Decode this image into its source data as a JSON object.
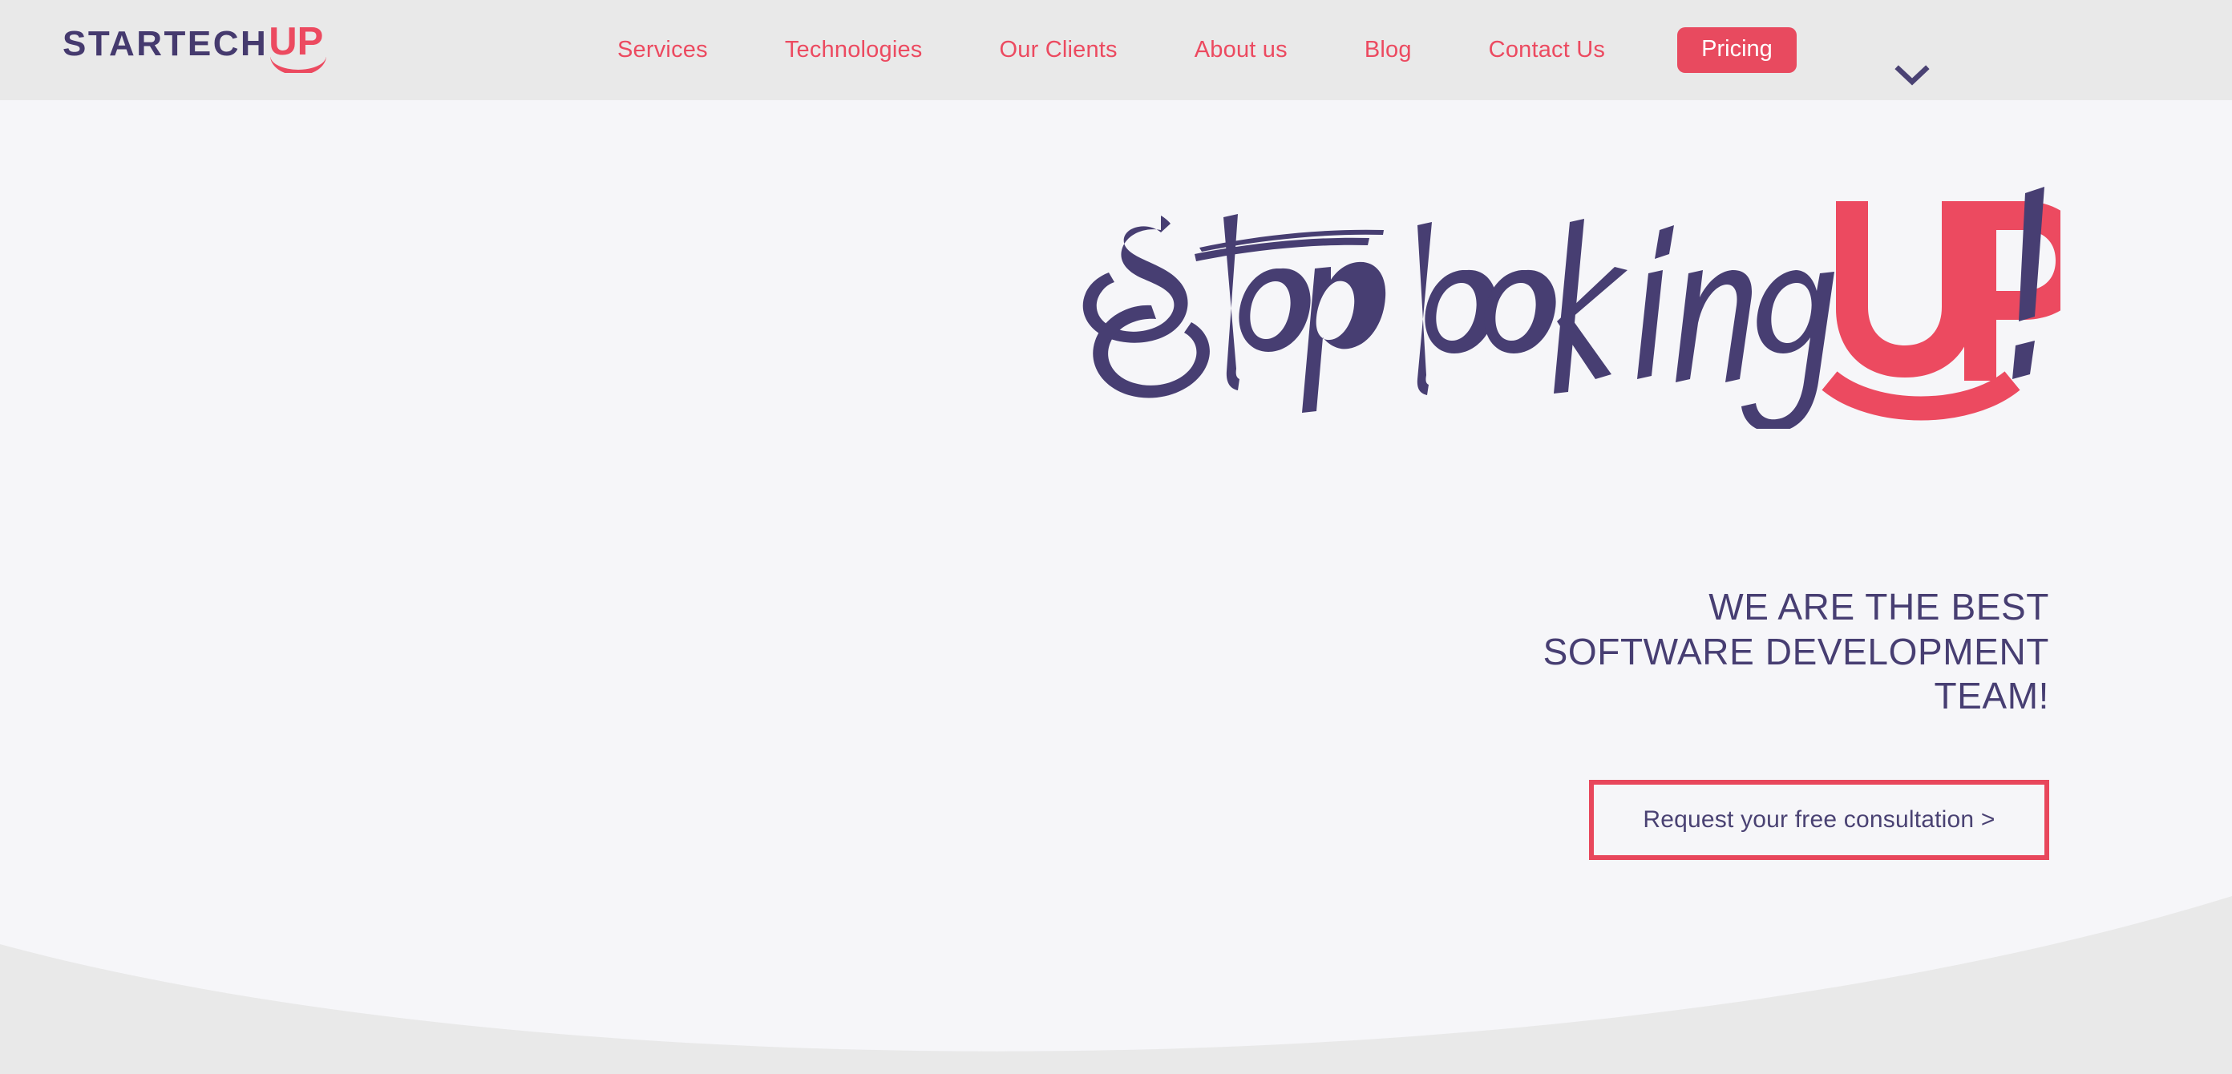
{
  "header": {
    "logo": {
      "primary_text": "STARTECH",
      "accent_text": "UP",
      "primary_color": "#453a6e",
      "accent_color": "#ec4a60",
      "smile_icon": "smile-arc-icon"
    },
    "nav_items": [
      {
        "label": "Services"
      },
      {
        "label": "Technologies"
      },
      {
        "label": "Our Clients"
      },
      {
        "label": "About us"
      },
      {
        "label": "Blog"
      },
      {
        "label": "Contact Us"
      }
    ],
    "pricing_label": "Pricing",
    "chevron_icon": "chevron-down-icon",
    "background_color": "#e9e9e9",
    "nav_link_color": "#ec4a60",
    "pricing_bg_color": "#e84a5f"
  },
  "hero": {
    "script_part_1": "Stop looking",
    "script_part_2": "UP",
    "script_exclamation": "!",
    "script_color": "#473e72",
    "script_accent_color": "#ec4a60",
    "subheadline": "WE ARE THE BEST\nSOFTWARE DEVELOPMENT\nTEAM!",
    "subheadline_color": "#473e72",
    "cta_label": "Request your free consultation >",
    "cta_text_color": "#4a4273",
    "highlight_color": "#e8475c",
    "background_color": "#f6f6f9",
    "curve_color": "#e9e9e9"
  }
}
